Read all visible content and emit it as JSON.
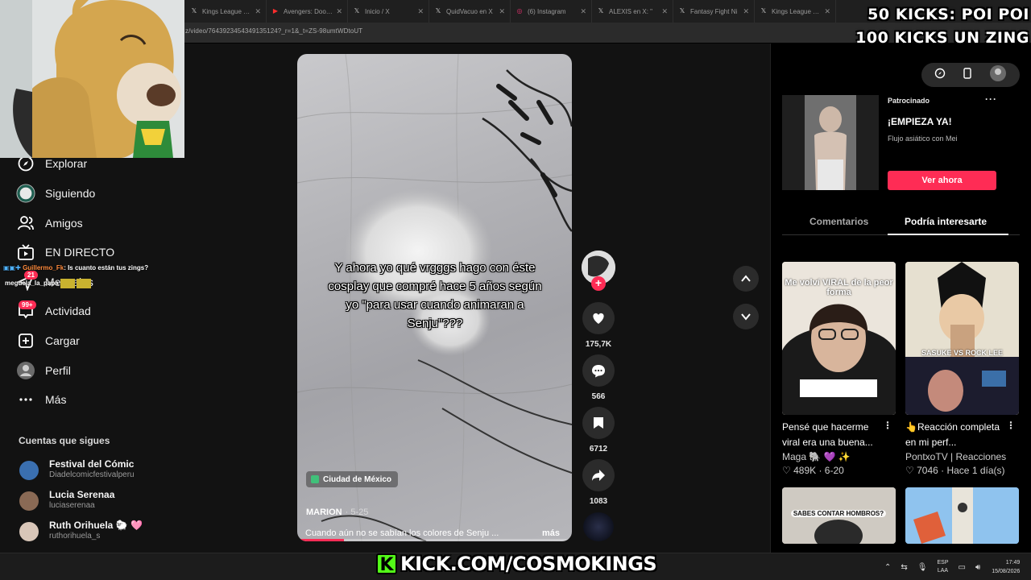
{
  "browser": {
    "tabs": [
      {
        "label": "Kings League Op",
        "icon": "x-icon"
      },
      {
        "label": "Avengers: Dooms",
        "icon": "youtube-icon"
      },
      {
        "label": "Inicio / X",
        "icon": "x-icon"
      },
      {
        "label": "QuidVacuo en X",
        "icon": "x-icon"
      },
      {
        "label": "(6) Instagram",
        "icon": "instagram-icon"
      },
      {
        "label": "ALEXIS en X: \"",
        "icon": "x-icon"
      },
      {
        "label": "Fantasy Fight Ni",
        "icon": "x-icon"
      },
      {
        "label": "Kings League Op",
        "icon": "x-icon"
      }
    ],
    "url": "z/video/7643923454349135124?_r=1&_t=ZS-98umtWDtoUT"
  },
  "sidebar": {
    "items": [
      {
        "label": "Explorar",
        "icon": "compass-icon"
      },
      {
        "label": "Siguiendo",
        "icon": "following-icon"
      },
      {
        "label": "Amigos",
        "icon": "friends-icon"
      },
      {
        "label": "EN DIRECTO",
        "icon": "live-icon"
      },
      {
        "label": "Mensajes",
        "icon": "messages-icon",
        "badge": "21"
      },
      {
        "label": "Actividad",
        "icon": "activity-icon",
        "badge": "99+"
      },
      {
        "label": "Cargar",
        "icon": "upload-icon"
      },
      {
        "label": "Perfil",
        "icon": "profile-icon"
      },
      {
        "label": "Más",
        "icon": "more-icon"
      }
    ],
    "following_title": "Cuentas que sigues",
    "accounts": [
      {
        "name": "Festival del Cómic",
        "handle": "Diadelcomicfestivalperu",
        "avatar_color": "#3a6fb0"
      },
      {
        "name": "Lucia Serenaa",
        "handle": "luciaserenaa",
        "avatar_color": "#8a6a55"
      },
      {
        "name": "Ruth Orihuela 🐑 🩷",
        "handle": "ruthorihuela_s",
        "avatar_color": "#d8c6b8"
      }
    ]
  },
  "chat": {
    "user": "Guillermo_Fk",
    "message": ": Is cuanto están tus zings?",
    "line2": "meguela_la_papa"
  },
  "video": {
    "overlay_text": "Y ahora yo qué vrgggs hago con éste cosplay que compré hace 5 años según yo \"para usar cuando animaran a Senju\"???",
    "location": "Ciudad de México",
    "author": "MARION",
    "date": "· 5-25",
    "description": "Cuando aún no se sabían los colores de Senju ...",
    "more": "más",
    "progress": 0.17
  },
  "actions": {
    "likes": "175,7K",
    "comments": "566",
    "saves": "6712",
    "shares": "1083"
  },
  "right_panel": {
    "ad": {
      "sponsored": "Patrocinado",
      "title": "¡EMPIEZA YA!",
      "subtitle": "Flujo asiático con Mei",
      "cta": "Ver ahora"
    },
    "tabs": [
      "Comentarios",
      "Podría interesarte"
    ],
    "cards": [
      {
        "title": "Pensé que hacerme viral era una buena...",
        "author": "Maga 🐘 💜 ✨",
        "views": "489K",
        "date": "6-20",
        "thumb_text": "Me volví VIRAL de la peor forma"
      },
      {
        "title": "👆Reacción completa en mi perf...",
        "author": "PontxoTV | Reacciones",
        "views": "7046",
        "date": "Hace 1 día(s)",
        "thumb_text": "SASUKE VS ROCK LEE"
      }
    ],
    "bottom_cards": [
      {
        "thumb_text": "SABES CONTAR HOMBROS?"
      },
      {
        "thumb_text": ""
      }
    ]
  },
  "stream_overlay": {
    "line1": "50 KICKS: POI POI",
    "line2": "100 KICKS UN ZING",
    "kick_logo": "K",
    "kick_url": "KICK.COM/COSMOKINGS"
  },
  "taskbar": {
    "lang1": "ESP",
    "lang2": "LAA",
    "time": "17:49",
    "date": "15/08/2026"
  },
  "colors": {
    "accent": "#fe2c55",
    "kick_green": "#53fc18",
    "background": "#121212"
  }
}
